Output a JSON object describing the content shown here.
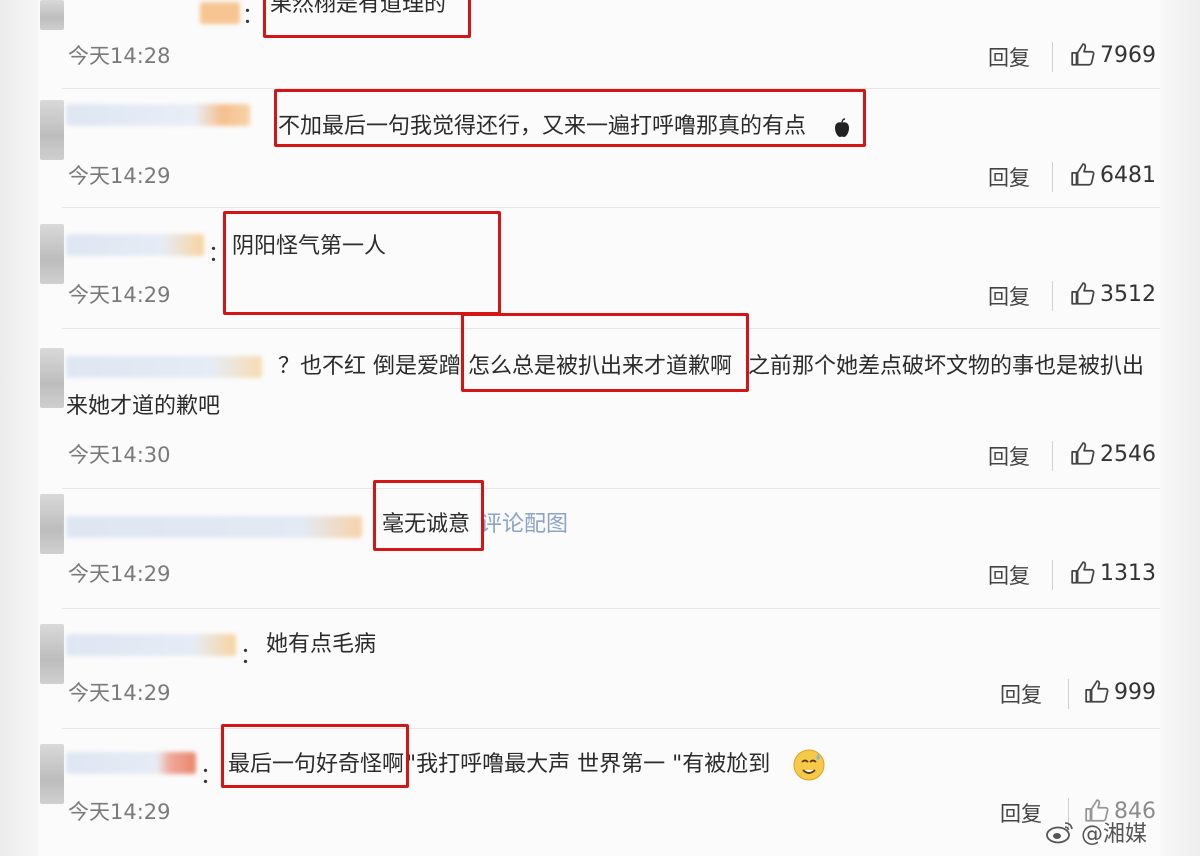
{
  "comments": [
    {
      "text": "果然栩是有道理的",
      "time": "今天14:28",
      "reply": "回复",
      "likes": "7969"
    },
    {
      "text": "不加最后一句我觉得还行，又来一遍打呼噜那真的有点",
      "time": "今天14:29",
      "reply": "回复",
      "likes": "6481"
    },
    {
      "text": "阴阳怪气第一人",
      "time": "今天14:29",
      "reply": "回复",
      "likes": "3512"
    },
    {
      "text_prefix": "？也不红 倒是爱蹭 ",
      "text_mid": "怎么总是被扒出来才道歉啊",
      "text_suffix": " 之前那个她差点破坏文物的事也是被扒出",
      "text_line2": "来她才道的歉吧",
      "time": "今天14:30",
      "reply": "回复",
      "likes": "2546"
    },
    {
      "text": "毫无诚意",
      "link": "评论配图",
      "time": "今天14:29",
      "reply": "回复",
      "likes": "1313"
    },
    {
      "text": "她有点毛病",
      "time": "今天14:29",
      "reply": "回复",
      "likes": "999"
    },
    {
      "text_highlight": "最后一句好奇怪啊",
      "text_rest": " \"我打呼噜最大声 世界第一 \"有被尬到",
      "time": "今天14:29",
      "reply": "回复",
      "likes": "846"
    }
  ],
  "colon": "：",
  "watermark": "@湘媒",
  "icons": {
    "like": "thumbs-up-icon",
    "emoji_apple": "apple-emoji-icon",
    "emoji_sweat": "sweat-smile-emoji-icon",
    "weibo": "weibo-logo-icon"
  },
  "colors": {
    "highlight_box": "#d41515",
    "link": "#8aa3c8"
  }
}
